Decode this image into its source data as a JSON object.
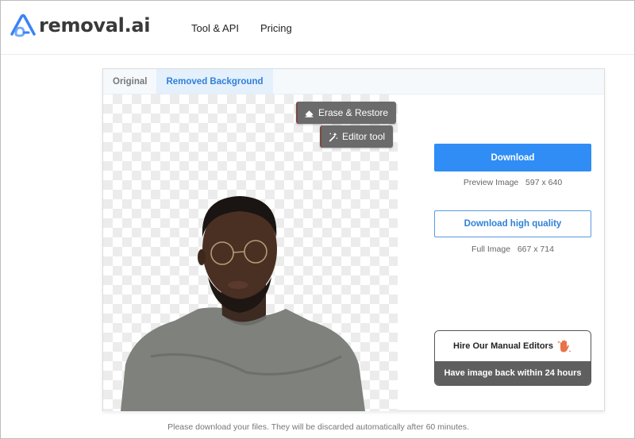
{
  "header": {
    "logo_text": "removal.ai",
    "nav": [
      {
        "label": "Tool & API"
      },
      {
        "label": "Pricing"
      }
    ]
  },
  "tabs": [
    {
      "label": "Original",
      "active": false
    },
    {
      "label": "Removed Background",
      "active": true
    }
  ],
  "canvas": {
    "erase_restore_label": "Erase & Restore",
    "editor_tool_label": "Editor tool"
  },
  "actions": {
    "download_label": "Download",
    "preview_label": "Preview Image",
    "preview_size": "597 x 640",
    "download_hq_label": "Download high quality",
    "full_label": "Full Image",
    "full_size": "667 x 714",
    "hire_label": "Hire Our Manual Editors",
    "hire_sub_label": "Have image back within 24 hours"
  },
  "footer": {
    "note": "Please download your files. They will be discarded automatically after 60 minutes."
  },
  "colors": {
    "brand_blue": "#2f8df5",
    "tab_active": "#2f80d8",
    "overlay_button": "#6b6b6b",
    "hire_accent": "#e8734a"
  }
}
